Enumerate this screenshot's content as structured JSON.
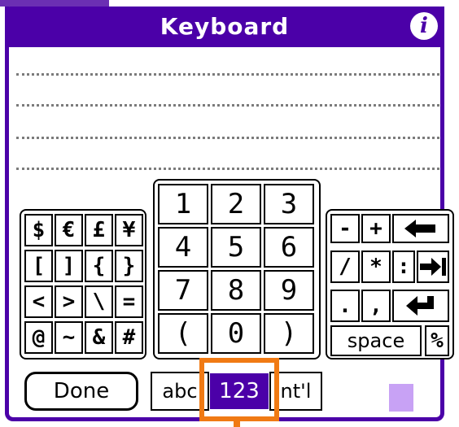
{
  "window": {
    "title": "Keyboard",
    "info_icon": "info-icon"
  },
  "symbols": [
    "$",
    "€",
    "£",
    "¥",
    "[",
    "]",
    "{",
    "}",
    "<",
    ">",
    "\\",
    "=",
    "@",
    "~",
    "&",
    "#"
  ],
  "numpad": [
    "1",
    "2",
    "3",
    "4",
    "5",
    "6",
    "7",
    "8",
    "9",
    "(",
    "0",
    ")"
  ],
  "operators": {
    "minus": "-",
    "plus": "+",
    "backspace_icon": "backspace-icon",
    "slash": "/",
    "asterisk": "*",
    "colon": ":",
    "tab_icon": "tab-icon",
    "period": ".",
    "comma": ",",
    "return_icon": "return-icon",
    "space": "space",
    "percent": "%"
  },
  "bottom": {
    "done": "Done",
    "mode_abc": "abc",
    "mode_123": "123",
    "mode_intl": "nt'l"
  },
  "colors": {
    "accent": "#4b00a8",
    "highlight": "#f07a14",
    "swatch": "#c8a2f5"
  }
}
